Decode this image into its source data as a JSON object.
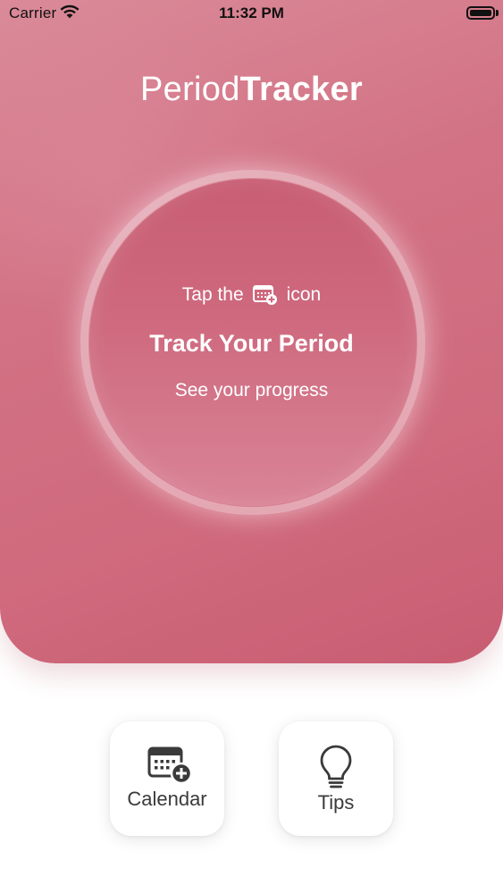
{
  "status_bar": {
    "carrier": "Carrier",
    "time": "11:32 PM"
  },
  "header": {
    "title_light": "Period",
    "title_bold": "Tracker"
  },
  "hero": {
    "line1_before": "Tap the",
    "line1_after": "icon",
    "headline": "Track Your Period",
    "subline": "See your progress",
    "inline_icon": "calendar-plus-icon"
  },
  "buttons": [
    {
      "label": "Calendar",
      "icon": "calendar-plus-icon"
    },
    {
      "label": "Tips",
      "icon": "lightbulb-icon"
    }
  ],
  "colors": {
    "accent": "#d06a7d",
    "accent_dark": "#c85d72",
    "text_on_accent": "#ffffff",
    "button_text": "#3a3a3a"
  }
}
